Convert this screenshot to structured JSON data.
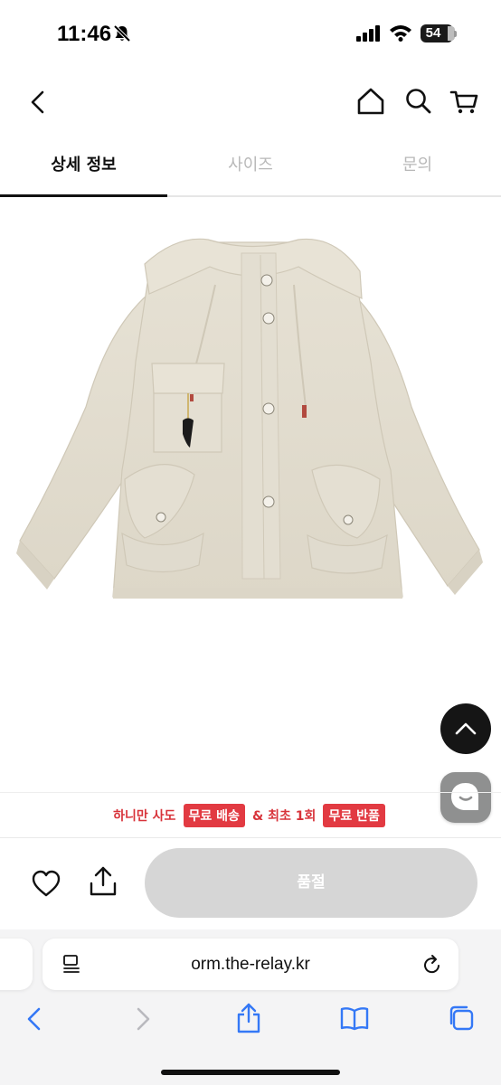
{
  "status_bar": {
    "time": "11:46",
    "battery": "54"
  },
  "header": {
    "back_icon": "chevron-left-icon",
    "home_icon": "home-icon",
    "search_icon": "search-icon",
    "cart_icon": "cart-icon"
  },
  "tabs": [
    {
      "label": "상세 정보",
      "active": true
    },
    {
      "label": "사이즈",
      "active": false
    },
    {
      "label": "문의",
      "active": false
    }
  ],
  "promo": {
    "text1": "하니만 사도",
    "badge1": "무료 배송",
    "text2": "& 최초 1회",
    "badge2": "무료 반품"
  },
  "action_bar": {
    "wishlist_icon": "heart-icon",
    "share_icon": "share-icon",
    "soldout_label": "품절"
  },
  "browser": {
    "url": "orm.the-relay.kr",
    "reader_icon": "reader-icon",
    "reload_icon": "reload-icon",
    "toolbar_icons": [
      "back-icon",
      "forward-icon",
      "share-icon",
      "bookmarks-icon",
      "tabs-icon"
    ]
  },
  "colors": {
    "promo_red": "#e23a42",
    "soldout_gray": "#d6d6d6",
    "jacket_beige": "#e2ddd0"
  }
}
